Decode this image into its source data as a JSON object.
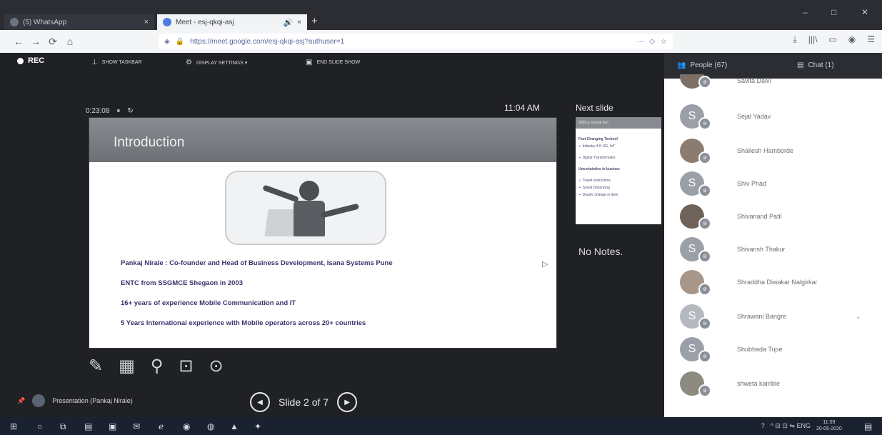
{
  "browser": {
    "tabs": [
      {
        "label": "(5) WhatsApp",
        "close": "×"
      },
      {
        "label": "Meet - esj-qkqi-asj",
        "audio": "🔊",
        "close": "×"
      }
    ],
    "new_tab": "+",
    "window_controls": {
      "minimize": "–",
      "maximize": "□",
      "close": "✕"
    },
    "url": "https://meet.google.com/esj-qkqi-asj?authuser=1",
    "nav": {
      "back": "←",
      "forward": "→",
      "reload": "⟳",
      "home": "⌂"
    },
    "address_menu": "···",
    "toolbar_icons": {
      "download": "⤓",
      "library": "|||\\",
      "reader": "▭",
      "account": "◉",
      "menu": "☰"
    }
  },
  "meet": {
    "rec_label": "REC",
    "controls": {
      "show_taskbar": "SHOW TASKBAR",
      "display_settings": "DISPLAY SETTINGS ▾",
      "end_slide_show": "END SLIDE SHOW"
    },
    "timer": "0:23:08",
    "pause_icon": "⏸",
    "restart_icon": "↻",
    "clock": "11:04 AM",
    "next_slide_label": "Next slide",
    "no_notes": "No Notes.",
    "slide": {
      "title": "Introduction",
      "bullets": [
        "Pankaj Nirale : Co-founder and Head of Business Development, Isana Systems Pune",
        "ENTC from SSGMCE Shegaon in 2003",
        "16+ years of experience Mobile Communication and IT",
        "5 Years International experience with Mobile operators across 20+ countries"
      ]
    },
    "next_thumb": {
      "bar": "2020 a Crucial Jun",
      "lines": [
        "Fast Changing Technol",
        "➢ Industry 4.0: 5G, IoT",
        "➢ Digital Transformatio",
        "Uncertainties in busines",
        "✓ Travel restrictions",
        "➢ Social Distancing",
        "➢ Drastic change in dem"
      ]
    },
    "tools": {
      "pen": "✎",
      "pointer": "▦",
      "zoom": "⚲",
      "screen": "⊡",
      "more": "⊙"
    },
    "presenting": "Presentation (Pankaj Nirale)",
    "slide_counter": "Slide 2 of 7",
    "prev": "◀",
    "next": "▶"
  },
  "panel": {
    "people_tab": "People (67)",
    "chat_tab": "Chat (1)",
    "people": [
      {
        "name": "Savita Dalvi",
        "initial": ""
      },
      {
        "name": "Sejal Yadav",
        "initial": "S"
      },
      {
        "name": "Shailesh Hamborde",
        "initial": ""
      },
      {
        "name": "Shiv Phad",
        "initial": "S"
      },
      {
        "name": "Shivanand Patil",
        "initial": ""
      },
      {
        "name": "Shivansh Thakur",
        "initial": "S"
      },
      {
        "name": "Shraddha Diwakar Nalgirkar",
        "initial": ""
      },
      {
        "name": "Shrawani Bangre",
        "initial": "S"
      },
      {
        "name": "Shubhada Tupe",
        "initial": "S"
      },
      {
        "name": "shweta kamble",
        "initial": ""
      }
    ],
    "chevron": "⌄"
  },
  "taskbar": {
    "icons": {
      "start": "⊞",
      "search": "○",
      "taskview": "⧉",
      "explorer": "▤",
      "store": "▣",
      "mail": "✉",
      "edge": "ℯ",
      "maps": "◉",
      "chrome": "◍",
      "vlc": "▲",
      "firefox": "✦"
    },
    "tray": "^  ⊟  ⊡  ⇋  ENG",
    "time": "11:09",
    "date": "20-05-2020",
    "notifications": "▤"
  }
}
